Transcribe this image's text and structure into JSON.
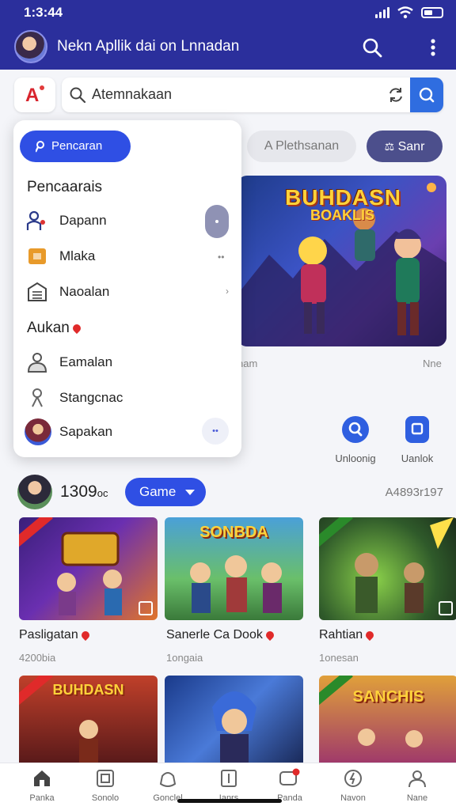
{
  "status": {
    "time": "1:3:44"
  },
  "appbar": {
    "title": "Nekn Apllik dai on Lnnadan"
  },
  "search": {
    "value": "Atemnakaan"
  },
  "chips": {
    "outline": "A Plethsanan",
    "dark": "Sanr"
  },
  "panel": {
    "button": "Pencaran",
    "section1": "Pencaarais",
    "items1": [
      {
        "label": "Dapann",
        "icon": "people-icon"
      },
      {
        "label": "Mlaka",
        "icon": "folder-icon"
      },
      {
        "label": "Naoalan",
        "icon": "building-icon"
      }
    ],
    "section2": "Aukan",
    "items2": [
      {
        "label": "Eamalan",
        "icon": "group-icon"
      },
      {
        "label": "Stangcnac",
        "icon": "person-icon"
      },
      {
        "label": "Sapakan",
        "icon": "avatar-icon"
      }
    ]
  },
  "banner": {
    "title": "BUHDASN",
    "subtitle": "BOAKLIS",
    "caption_left": "nam",
    "caption_right": "Nne"
  },
  "quick_actions": [
    {
      "label": "Unloonig",
      "icon": "search-icon"
    },
    {
      "label": "Uanlok",
      "icon": "badge-icon"
    }
  ],
  "section": {
    "count": "1309",
    "suffix": "oc",
    "pill": "Game",
    "right": "A4893r197"
  },
  "games": [
    {
      "label": "Pasligatan",
      "sub": "4200bia",
      "title": ""
    },
    {
      "label": "Sanerle Ca Dook",
      "sub": "1ongaia",
      "title": "SONBDA"
    },
    {
      "label": "Rahtian",
      "sub": "1onesan",
      "title": ""
    },
    {
      "label": "",
      "sub": "",
      "title": "BUHDASN"
    },
    {
      "label": "",
      "sub": "",
      "title": ""
    },
    {
      "label": "",
      "sub": "",
      "title": "SANCHIS"
    }
  ],
  "nav": [
    {
      "label": "Panka",
      "icon": "home-icon"
    },
    {
      "label": "Sonolo",
      "icon": "store-icon"
    },
    {
      "label": "Gonclel",
      "icon": "controller-icon"
    },
    {
      "label": "Ianrs",
      "icon": "book-icon"
    },
    {
      "label": "Panda",
      "icon": "chat-icon"
    },
    {
      "label": "Navon",
      "icon": "power-icon"
    },
    {
      "label": "Nane",
      "icon": "profile-icon"
    }
  ],
  "colors": {
    "primary": "#2b2f9c",
    "accent": "#2f4fe4",
    "danger": "#e02a2a"
  }
}
